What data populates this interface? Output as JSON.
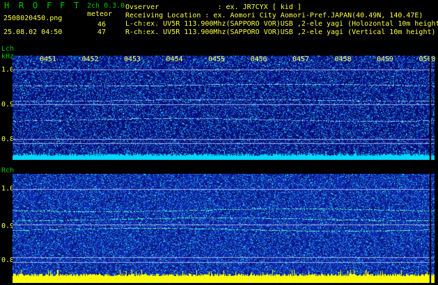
{
  "header": {
    "title_letters": [
      "H",
      "R",
      "O",
      "F",
      "F",
      "T"
    ],
    "mode": "2ch 0.3.0",
    "meteor_label": "meteor",
    "filename": "2508020450.png",
    "meteor_count_l": "46",
    "meteor_count_r": "47",
    "datetime": "25.08.02 04:50",
    "observer": "Ovserver              : ex. JR7CYX [ kid ]",
    "location": "Receiving Location : ex. Aomori City Aomori-Pref.JAPAN(40.49N, 140.47E)",
    "lch_info": "L-ch:ex. UV5R 113.900Mhz(SAPPORO VOR)USB ,2-ele yagi (Holozontal 10m height)",
    "rch_info": "R-ch:ex. UV5R 113.900Mhz(SAPPORO VOR)USB ,2-ele yagi (Vertical 10m height)"
  },
  "lch_panel": {
    "label": "Lch",
    "unit": "kHz",
    "y_ticks": [
      "1.0",
      "0.9",
      "0.8"
    ],
    "time_labels": [
      "0451",
      "0452",
      "0453",
      "0454",
      "0455",
      "0456",
      "0457",
      "0458",
      "0459",
      "0500"
    ]
  },
  "rch_panel": {
    "label": "Rch",
    "y_ticks": [
      "1.0",
      "0.9",
      "0.8"
    ]
  },
  "colors": {
    "text_green": "#00c800",
    "text_yellow": "#ffff40",
    "lch_background": "#0a1a8c",
    "rch_background": "#1030b0",
    "level_bar_l": "#00d8ff",
    "level_bar_r": "#ffff00"
  }
}
